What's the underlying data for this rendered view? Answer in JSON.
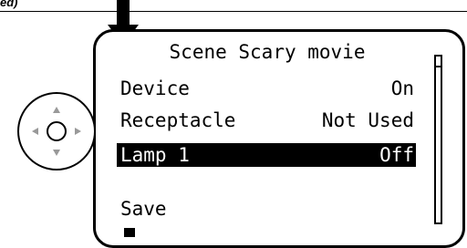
{
  "caption": "ed)",
  "icons": {
    "pointer": "down-arrow-icon",
    "dpad": "navigation-dpad-icon",
    "scroll_up": "triangle-up-icon",
    "scroll_down": "triangle-down-icon",
    "scroll_left": "triangle-left-icon",
    "scroll_right": "triangle-right-icon"
  },
  "screen": {
    "title": "Scene Scary movie",
    "rows": [
      {
        "label": "Device",
        "value": "On",
        "selected": false
      },
      {
        "label": "Receptacle",
        "value": "Not Used",
        "selected": false
      },
      {
        "label": "Lamp 1",
        "value": "Off",
        "selected": true
      }
    ],
    "save_label": "Save"
  },
  "colors": {
    "foreground": "#000000",
    "background": "#ffffff",
    "dpad_icon": "#999999"
  }
}
